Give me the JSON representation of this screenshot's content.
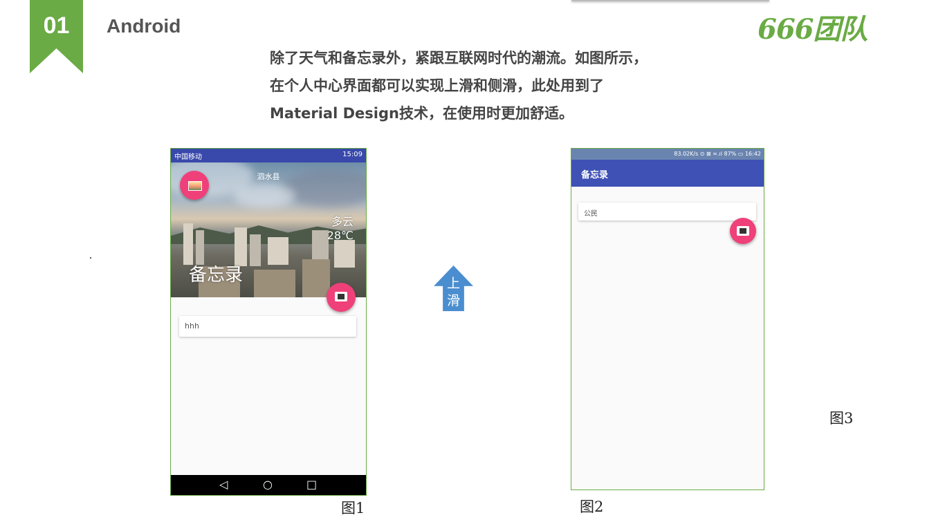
{
  "header": {
    "section_number": "01",
    "section_title": "Android",
    "logo_text": "666团队"
  },
  "description": {
    "lines": [
      "除了天气和备忘录外，紧跟互联网时代的潮流。如图所示，",
      "在个人中心界面都可以实现上滑和侧滑，此处用到了",
      "Material Design技术，在使用时更加舒适。"
    ]
  },
  "phone1": {
    "status_left": "中国移动",
    "status_time": "15:09",
    "city": "泗水县",
    "weather": "多云",
    "temperature": "28℃",
    "big_title": "备忘录",
    "card_text": "hhh",
    "nav": {
      "back": "◁",
      "home": "○",
      "recent": "□"
    },
    "caption": "图1"
  },
  "arrow": {
    "line1": "上",
    "line2": "滑"
  },
  "phone2": {
    "status_right": "83.02K/s ⊙ ⊠ ≈.ıl 87% ▭ 16:42",
    "toolbar_title": "备忘录",
    "card_text": "公民",
    "caption": "图2"
  },
  "caption3": "图3",
  "colors": {
    "accent_green": "#6aab45",
    "primary_indigo": "#3f51b5",
    "fab_pink": "#f0407a"
  }
}
